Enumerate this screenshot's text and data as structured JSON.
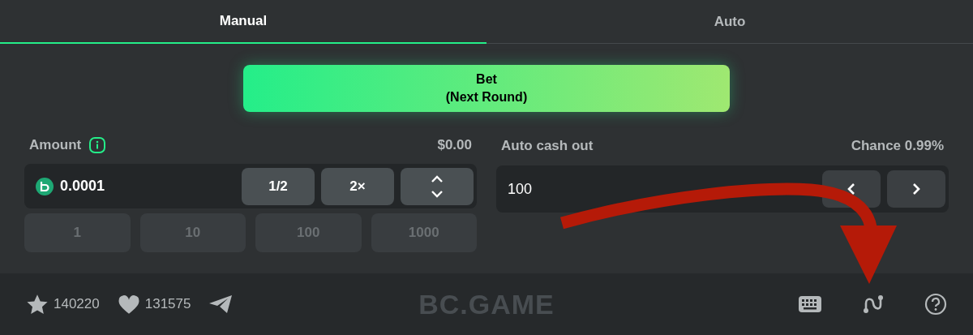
{
  "tabs": [
    {
      "label": "Manual",
      "selected": true
    },
    {
      "label": "Auto",
      "selected": false
    }
  ],
  "bet_button": {
    "label": "Bet",
    "sublabel": "(Next Round)"
  },
  "amount": {
    "label": "Amount",
    "usd": "$0.00",
    "value": "0.0001",
    "actions": [
      "1/2",
      "2×"
    ],
    "presets": [
      "1",
      "10",
      "100",
      "1000"
    ]
  },
  "auto_cash_out": {
    "label": "Auto cash out",
    "chance": "Chance 0.99%",
    "value": "100"
  },
  "footer": {
    "stars": "140220",
    "likes": "131575",
    "logo": "BC.GAME"
  }
}
